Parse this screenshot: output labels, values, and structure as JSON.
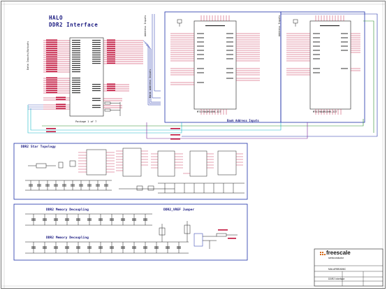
{
  "title": {
    "line1": "HALO",
    "line2": "DDR2  Interface"
  },
  "sections": {
    "star_topology": "DDR2 Star Topology",
    "decoupling_top": "DDR2 Memory Decoupling",
    "decoupling_bottom": "DDR2 Memory Decoupling",
    "vref_jumper": "DDR2_VREF Jumper"
  },
  "labels": {
    "bank_address_inputs": "Bank Address Inputs",
    "address_inputs_left": "Address Inputs",
    "address_inputs_right": "Address Inputs",
    "bank_address_inputs_vert": "Bank Address Inputs",
    "data_inputs": "Data Inputs/Outputs",
    "package": "Package 1 of 7",
    "part_left": "MT47H64M16HR-3IT",
    "part_right": "MT47H64M16HR-3IT"
  },
  "title_block": {
    "brand": "freescale",
    "brand_sub": "semiconductor",
    "project": "MALARBEAB6C",
    "sheet": "DDR2 Interface"
  },
  "colors": {
    "net": "#c0103a",
    "wire_blue": "#1d2fa8",
    "wire_cyan": "#18b8c8",
    "wire_green": "#2a8a2a",
    "wire_purple": "#7a2a9a",
    "component": "#1a1a1a",
    "text": "#1a1a80"
  }
}
